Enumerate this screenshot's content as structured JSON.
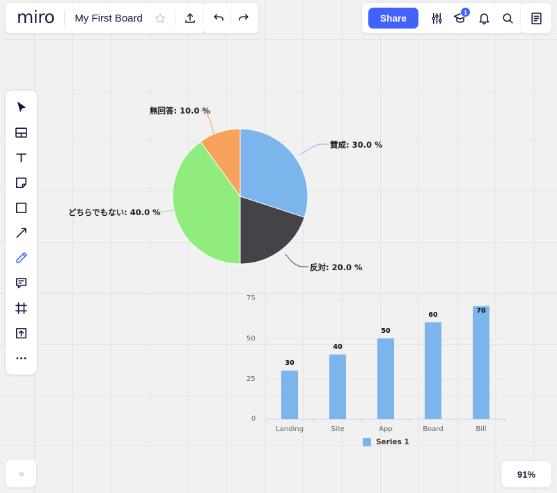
{
  "app": {
    "logo_text": "miro",
    "board_title": "My First Board"
  },
  "header": {
    "star_icon": "star-icon",
    "upload_icon": "upload-icon",
    "undo_icon": "undo-icon",
    "redo_icon": "redo-icon",
    "share_label": "Share",
    "settings_icon": "sliders-icon",
    "learning_icon": "graduation-cap-icon",
    "learning_badge": "1",
    "notifications_icon": "bell-icon",
    "search_icon": "search-icon",
    "notes_icon": "notes-panel-icon"
  },
  "toolbar": {
    "items": [
      {
        "name": "cursor-tool",
        "icon": "cursor-icon",
        "active": false
      },
      {
        "name": "templates-tool",
        "icon": "templates-icon",
        "active": false
      },
      {
        "name": "text-tool",
        "icon": "text-icon",
        "active": false
      },
      {
        "name": "sticky-note-tool",
        "icon": "sticky-note-icon",
        "active": false
      },
      {
        "name": "shape-tool",
        "icon": "square-icon",
        "active": false
      },
      {
        "name": "connector-tool",
        "icon": "arrow-icon",
        "active": false
      },
      {
        "name": "pen-tool",
        "icon": "pencil-icon",
        "active": true
      },
      {
        "name": "comment-tool",
        "icon": "comment-icon",
        "active": false
      },
      {
        "name": "frame-tool",
        "icon": "frame-icon",
        "active": false
      },
      {
        "name": "upload-tool",
        "icon": "upload-box-icon",
        "active": false
      },
      {
        "name": "more-tools",
        "icon": "ellipsis-icon",
        "active": false
      }
    ]
  },
  "footer": {
    "collapse_label": "»",
    "zoom_level": "91%"
  },
  "chart_data": [
    {
      "type": "pie",
      "title": "",
      "labels": [
        "賛成",
        "反対",
        "どちらでもない",
        "無回答"
      ],
      "values": [
        30.0,
        20.0,
        40.0,
        10.0
      ],
      "colors": [
        "#7cb5ec",
        "#434348",
        "#90ed7d",
        "#f7a35c"
      ],
      "data_labels": [
        "賛成: 30.0 %",
        "反対: 20.0 %",
        "どちらでもない: 40.0 %",
        "無回答: 10.0 %"
      ],
      "legend": false,
      "start_angle": 0
    },
    {
      "type": "bar",
      "title": "",
      "xlabel": "",
      "ylabel": "",
      "categories": [
        "Landing",
        "Site",
        "App",
        "Board",
        "Bill"
      ],
      "values": [
        30,
        40,
        50,
        60,
        70
      ],
      "data_labels": [
        "30",
        "40",
        "50",
        "60",
        "70"
      ],
      "ylim": [
        0,
        75
      ],
      "yticks": [
        "0",
        "25",
        "50",
        "75"
      ],
      "grid": true,
      "series": [
        {
          "name": "Series 1",
          "values": [
            30,
            40,
            50,
            60,
            70
          ],
          "color": "#7cb5ec"
        }
      ],
      "legend_position": "bottom"
    }
  ]
}
